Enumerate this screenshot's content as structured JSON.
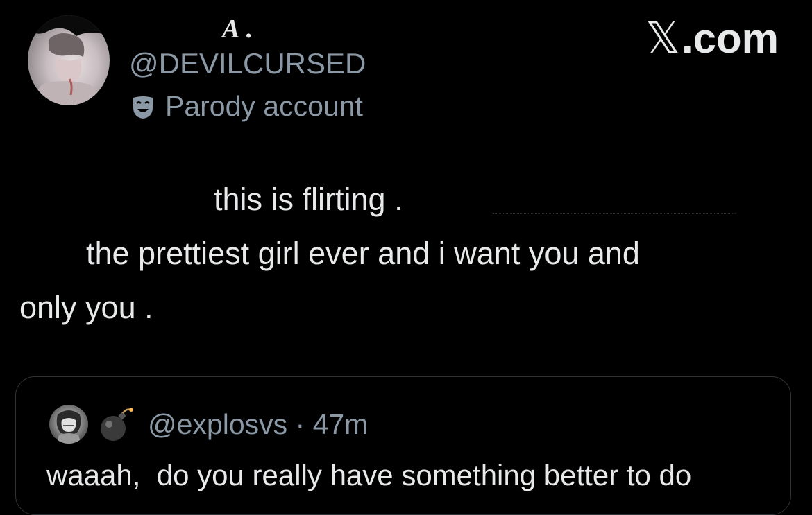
{
  "author": {
    "display_name": "A .",
    "handle": "@DEVILCURSED",
    "parody_label": "Parody account",
    "avatar_icon": "profile-photo",
    "parody_icon": "theater-mask-icon"
  },
  "brand": {
    "watermark": "X.com",
    "x_glyph": "𝕏",
    "suffix": ".com"
  },
  "post": {
    "lines": [
      "this is flirting .",
      "the prettiest girl ever and i want you and",
      "only you ."
    ]
  },
  "quoted_post": {
    "handle_meta": "@explosvs · 47m",
    "text": "waaah,  do you really have something better to do",
    "avatar_icon": "profile-photo",
    "badge_icon": "bomb-icon"
  },
  "colors": {
    "background": "#000000",
    "primary_text": "#e7e9ea",
    "secondary_text": "#8b98a5",
    "card_border": "#2f3336"
  }
}
